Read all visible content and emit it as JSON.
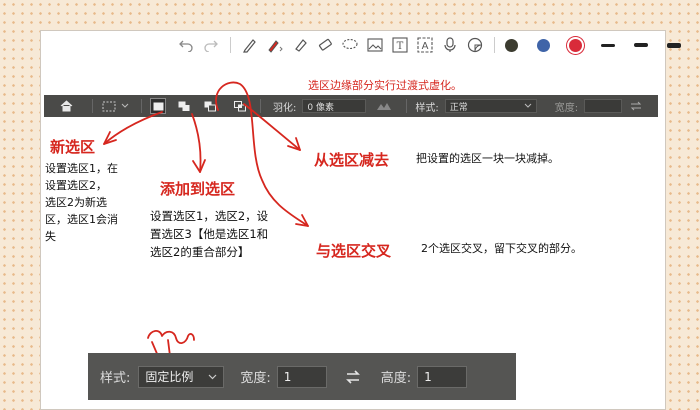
{
  "note_toolbar": {
    "icons": [
      "undo-icon",
      "redo-icon",
      "pen-icon",
      "marker-icon",
      "highlighter-icon",
      "eraser-icon",
      "lasso-icon",
      "image-icon",
      "text-box-icon",
      "text-recognize-icon",
      "microphone-icon",
      "sticker-icon"
    ],
    "colors": [
      "#3c3c30",
      "#3f64a8",
      "#d92b3a"
    ]
  },
  "ps_options_bar": {
    "feather_label": "羽化:",
    "feather_value": "0 像素",
    "style_label": "样式:",
    "style_value": "正常",
    "width_label": "宽度:"
  },
  "annotations": {
    "top_note": "选区边缘部分实行过渡式虚化。",
    "new_selection": {
      "title": "新选区",
      "lines": [
        "设置选区1，在",
        "设置选区2，",
        "选区2为新选",
        "区，选区1会消",
        "失"
      ]
    },
    "add_to_selection": {
      "title": "添加到选区",
      "lines": [
        "设置选区1，选区2，设",
        "置选区3【他是选区1和",
        "选区2的重合部分】"
      ]
    },
    "subtract_from_selection": {
      "title": "从选区减去",
      "desc": "把设置的选区一块一块减掉。"
    },
    "intersect_selection": {
      "title": "与选区交叉",
      "desc": "2个选区交叉，留下交叉的部分。"
    }
  },
  "ps_style_bar": {
    "style_label": "样式:",
    "style_value": "固定比例",
    "width_label": "宽度:",
    "width_value": "1",
    "height_label": "高度:",
    "height_value": "1"
  }
}
